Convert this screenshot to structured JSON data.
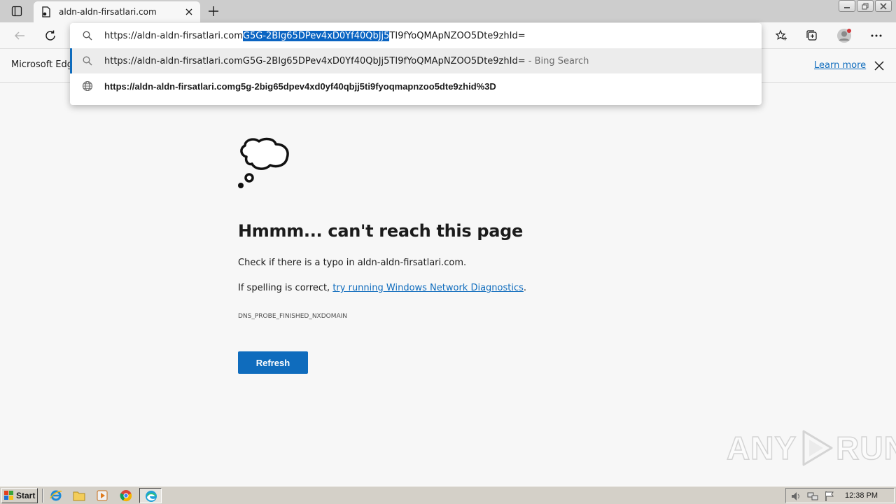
{
  "tab": {
    "title": "aldn-aldn-firsatlari.com"
  },
  "omnibox": {
    "input_prefix": "https://aldn-aldn-firsatlari.com",
    "input_selected": "G5G-2BIg65DPev4xD0Yf40QbJj5",
    "input_suffix": "TI9fYoQMApNZOO5Dte9zhId=",
    "suggestion_text": "https://aldn-aldn-firsatlari.comG5G-2BIg65DPev4xD0Yf40QbJj5TI9fYoQMApNZOO5Dte9zhId=",
    "suggestion_suffix": "- Bing Search",
    "url_suggestion": "https://aldn-aldn-firsatlari.comg5g-2big65dpev4xd0yf40qbjj5ti9fyoqmapnzoo5dte9zhid%3D"
  },
  "infobar": {
    "text": "Microsoft Edge",
    "learn_more": "Learn more"
  },
  "error": {
    "title": "Hmmm... can't reach this page",
    "line1": "Check if there is a typo in aldn-aldn-firsatlari.com.",
    "line2_prefix": "If spelling is correct, ",
    "line2_link": "try running Windows Network Diagnostics",
    "line2_suffix": ".",
    "code": "DNS_PROBE_FINISHED_NXDOMAIN",
    "refresh_label": "Refresh"
  },
  "watermark": {
    "text_left": "ANY",
    "text_right": "RUN"
  },
  "taskbar": {
    "start_label": "Start",
    "clock": "12:38 PM"
  },
  "colors": {
    "accent": "#0f6cbd",
    "selection": "#0a64c2",
    "taskbar": "#d4d0c8"
  }
}
